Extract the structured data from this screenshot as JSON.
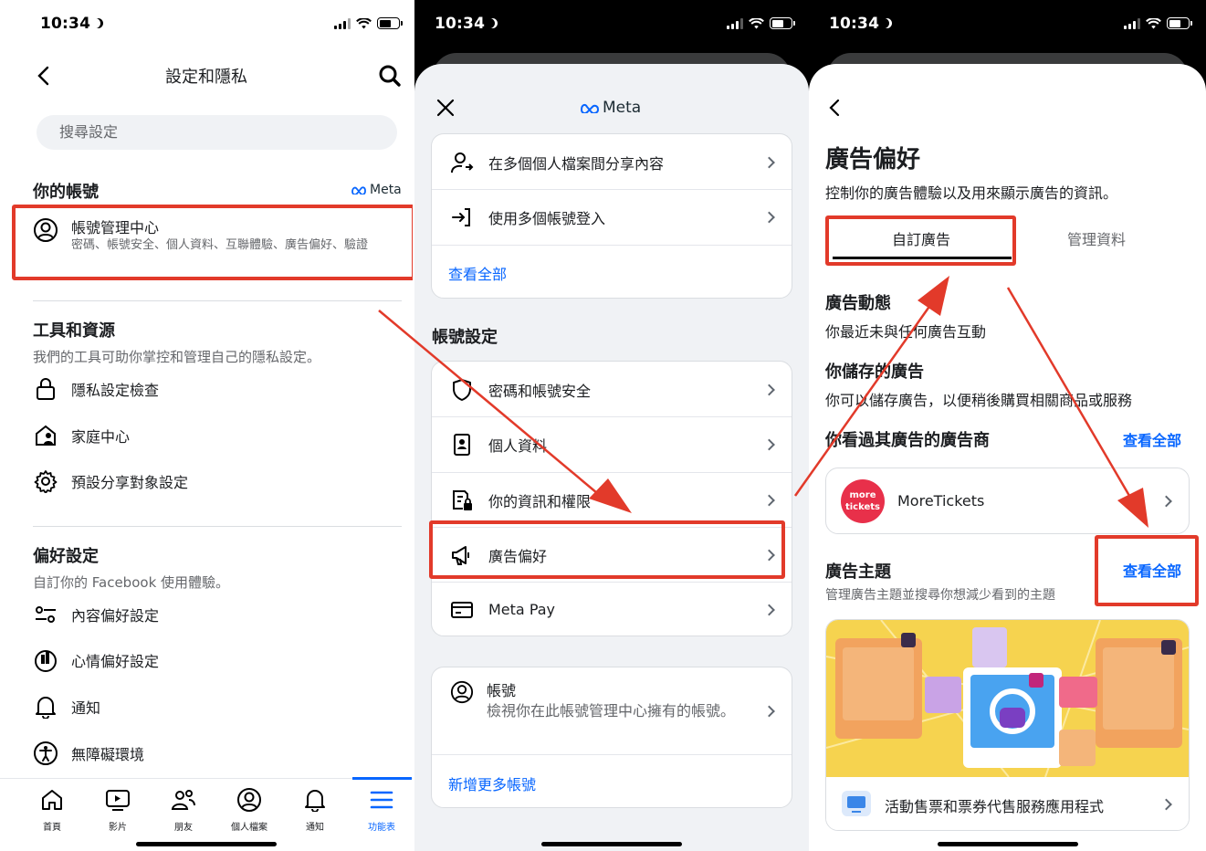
{
  "status": {
    "time": "10:34"
  },
  "panel1": {
    "title": "設定和隱私",
    "search_placeholder": "搜尋設定",
    "account_section": {
      "title": "你的帳號",
      "meta_label": "Meta"
    },
    "accounts_center": {
      "title": "帳號管理中心",
      "subtitle": "密碼、帳號安全、個人資料、互聯體驗、廣告偏好、驗證"
    },
    "tools_section": {
      "title": "工具和資源",
      "subtitle": "我們的工具可助你掌控和管理自己的隱私設定。",
      "items": [
        {
          "label": "隱私設定檢查",
          "icon": "lock-icon"
        },
        {
          "label": "家庭中心",
          "icon": "family-center-icon"
        },
        {
          "label": "預設分享對象設定",
          "icon": "gear-icon"
        }
      ]
    },
    "preferences_section": {
      "title": "偏好設定",
      "subtitle": "自訂你的 Facebook 使用體驗。",
      "items": [
        {
          "label": "內容偏好設定",
          "icon": "sliders-icon"
        },
        {
          "label": "心情偏好設定",
          "icon": "reaction-icon"
        },
        {
          "label": "通知",
          "icon": "bell-icon"
        },
        {
          "label": "無障礙環境",
          "icon": "accessibility-icon"
        }
      ]
    },
    "tabbar": [
      {
        "label": "首頁",
        "icon": "home-icon"
      },
      {
        "label": "影片",
        "icon": "video-icon"
      },
      {
        "label": "朋友",
        "icon": "friends-icon"
      },
      {
        "label": "個人檔案",
        "icon": "profile-icon"
      },
      {
        "label": "通知",
        "icon": "bell-icon"
      },
      {
        "label": "功能表",
        "icon": "menu-icon",
        "active": true
      }
    ]
  },
  "panel2": {
    "brand": "Meta",
    "top_card": {
      "items": [
        {
          "label": "在多個個人檔案間分享內容",
          "icon": "share-profiles-icon"
        },
        {
          "label": "使用多個帳號登入",
          "icon": "login-icon"
        }
      ],
      "see_all": "查看全部"
    },
    "account_settings": {
      "title": "帳號設定",
      "items": [
        {
          "label": "密碼和帳號安全",
          "icon": "shield-icon"
        },
        {
          "label": "個人資料",
          "icon": "id-card-icon"
        },
        {
          "label": "你的資訊和權限",
          "icon": "info-permissions-icon"
        },
        {
          "label": "廣告偏好",
          "icon": "megaphone-icon"
        },
        {
          "label": "Meta Pay",
          "icon": "card-icon"
        }
      ]
    },
    "accounts_card": {
      "title": "帳號",
      "subtitle": "檢視你在此帳號管理中心擁有的帳號。",
      "add_link": "新增更多帳號"
    }
  },
  "panel3": {
    "title": "廣告偏好",
    "subtitle": "控制你的廣告體驗以及用來顯示廣告的資訊。",
    "tabs": [
      "自訂廣告",
      "管理資料"
    ],
    "ad_activity": {
      "title": "廣告動態",
      "text": "你最近未與任何廣告互動"
    },
    "saved_ads": {
      "title": "你儲存的廣告",
      "text": "你可以儲存廣告，以便稍後購買相關商品或服務"
    },
    "advertisers": {
      "title": "你看過其廣告的廣告商",
      "see_all": "查看全部",
      "advertiser": "MoreTickets",
      "logo_text_1": "more",
      "logo_text_2": "tickets"
    },
    "ad_topics": {
      "title": "廣告主題",
      "subtitle": "管理廣告主題並搜尋你想減少看到的主題",
      "see_all": "查看全部",
      "topic": "活動售票和票券代售服務應用程式"
    }
  },
  "colors": {
    "accent": "#0866ff",
    "annotation": "#e23a2a"
  }
}
